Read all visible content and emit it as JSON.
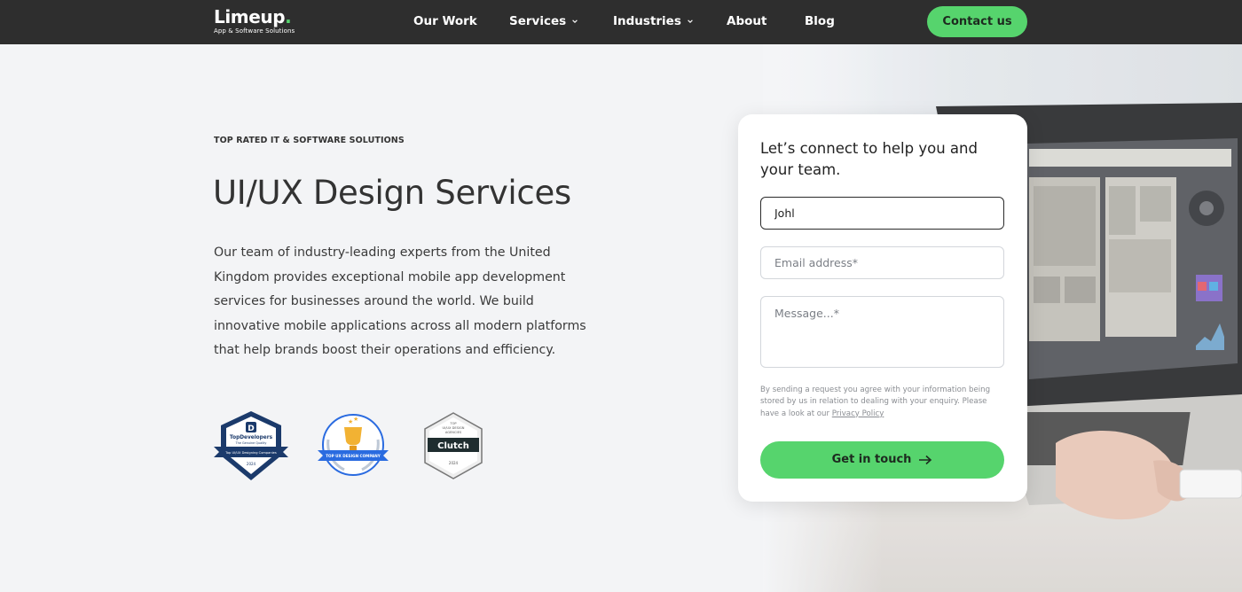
{
  "nav": {
    "logo_text": "Limeup",
    "logo_dot": ".",
    "logo_tagline": "App & Software Solutions",
    "items": [
      {
        "label": "Our Work",
        "has_dropdown": false
      },
      {
        "label": "Services",
        "has_dropdown": true
      },
      {
        "label": "Industries",
        "has_dropdown": true
      },
      {
        "label": "About",
        "has_dropdown": false
      },
      {
        "label": "Blog",
        "has_dropdown": false
      }
    ],
    "cta_label": "Contact us"
  },
  "hero": {
    "eyebrow": "TOP RATED IT & SOFTWARE SOLUTIONS",
    "title": "UI/UX Design Services",
    "description": "Our team of industry-leading experts from the United Kingdom provides exceptional mobile app development services for businesses around the world. We build innovative mobile applications across all modern platforms that help brands boost their operations and efficiency."
  },
  "badges": [
    {
      "name": "TopDevelopers",
      "lines": [
        "TopDevelopers",
        "The Genuine Quality",
        "Top UI/UX Designing Companies",
        "2024"
      ]
    },
    {
      "name": "Top UX Design Company",
      "lines": [
        "TOP UX DESIGN COMPANY"
      ]
    },
    {
      "name": "Clutch",
      "lines": [
        "TOP",
        "UI/UX DESIGN",
        "AGENCIES",
        "Clutch",
        "2024"
      ]
    }
  ],
  "form": {
    "title": "Let’s connect to help you and your team.",
    "name_value": "Johl",
    "email_placeholder": "Email address*",
    "message_placeholder": "Message...*",
    "consent_text": "By sending a request you agree with your information being stored by us in relation to dealing with your enquiry. Please have a look at our ",
    "privacy_link": "Privacy Policy",
    "submit_label": "Get in touch"
  },
  "colors": {
    "nav_bg": "#2e2e2e",
    "accent": "#56d46d",
    "page_bg": "#f3f4f6"
  }
}
